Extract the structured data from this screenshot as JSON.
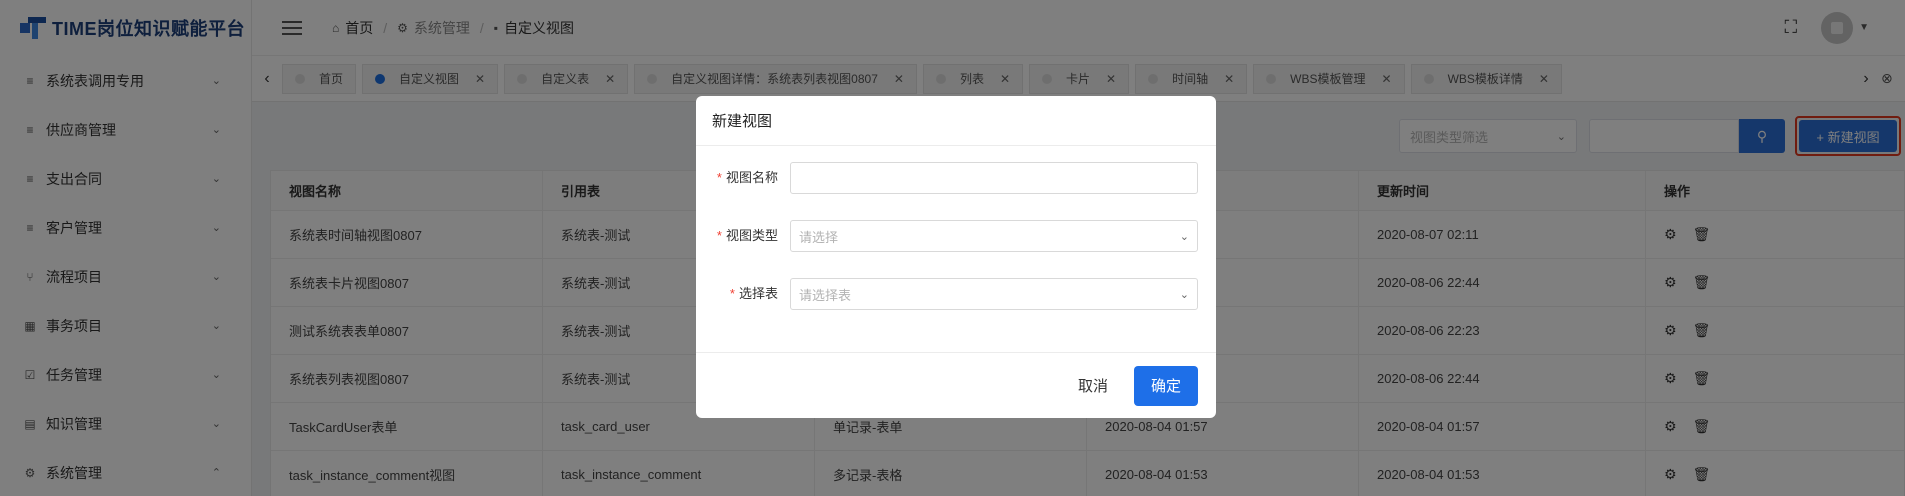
{
  "app": {
    "title": "TIME岗位知识赋能平台"
  },
  "sidebar": {
    "items": [
      {
        "label": "系统表调用专用",
        "icon": "≡",
        "arrow": "⌄"
      },
      {
        "label": "供应商管理",
        "icon": "≡",
        "arrow": "⌄"
      },
      {
        "label": "支出合同",
        "icon": "≡",
        "arrow": "⌄"
      },
      {
        "label": "客户管理",
        "icon": "≡",
        "arrow": "⌄"
      },
      {
        "label": "流程项目",
        "icon": "⑂",
        "arrow": "⌄"
      },
      {
        "label": "事务项目",
        "icon": "▦",
        "arrow": "⌄"
      },
      {
        "label": "任务管理",
        "icon": "☑",
        "arrow": "⌄"
      },
      {
        "label": "知识管理",
        "icon": "▤",
        "arrow": "⌄"
      },
      {
        "label": "系统管理",
        "icon": "⚙",
        "arrow": "⌃"
      }
    ]
  },
  "header": {
    "breadcrumb": [
      {
        "label": "首页",
        "icon": "⌂"
      },
      {
        "label": "系统管理",
        "icon": "⚙"
      },
      {
        "label": "自定义视图",
        "icon": "▪"
      }
    ],
    "separator": "/"
  },
  "tabs": {
    "left_arrow": "‹",
    "right_arrow": "›",
    "close_all": "⊗",
    "items": [
      {
        "label": "首页",
        "closable": false,
        "active": false
      },
      {
        "label": "自定义视图",
        "closable": true,
        "active": true
      },
      {
        "label": "自定义表",
        "closable": true,
        "active": false
      },
      {
        "label": "自定义视图详情：系统表列表视图0807",
        "closable": true,
        "active": false
      },
      {
        "label": "列表",
        "closable": true,
        "active": false
      },
      {
        "label": "卡片",
        "closable": true,
        "active": false
      },
      {
        "label": "时间轴",
        "closable": true,
        "active": false
      },
      {
        "label": "WBS模板管理",
        "closable": true,
        "active": false
      },
      {
        "label": "WBS模板详情",
        "closable": true,
        "active": false
      }
    ]
  },
  "toolbar": {
    "type_filter_placeholder": "视图类型筛选",
    "new_view_label": "+ 新建视图"
  },
  "table": {
    "columns": [
      "视图名称",
      "引用表",
      "",
      "",
      "更新时间",
      "操作"
    ],
    "rows": [
      [
        "系统表时间轴视图0807",
        "系统表-测试",
        "",
        "",
        "2020-08-07 02:11"
      ],
      [
        "系统表卡片视图0807",
        "系统表-测试",
        "",
        "",
        "2020-08-06 22:44"
      ],
      [
        "测试系统表表单0807",
        "系统表-测试",
        "",
        "",
        "2020-08-06 22:23"
      ],
      [
        "系统表列表视图0807",
        "系统表-测试",
        "",
        "",
        "2020-08-06 22:44"
      ],
      [
        "TaskCardUser表单",
        "task_card_user",
        "单记录-表单",
        "2020-08-04 01:57",
        "2020-08-04 01:57"
      ],
      [
        "task_instance_comment视图",
        "task_instance_comment",
        "多记录-表格",
        "2020-08-04 01:53",
        "2020-08-04 01:53"
      ]
    ]
  },
  "modal": {
    "title": "新建视图",
    "fields": [
      {
        "label": "视图名称",
        "value": "",
        "placeholder": ""
      },
      {
        "label": "视图类型",
        "value": "",
        "placeholder": "请选择"
      },
      {
        "label": "选择表",
        "value": "",
        "placeholder": "请选择表"
      }
    ],
    "required_mark": "*",
    "cancel_label": "取消",
    "ok_label": "确定"
  },
  "colors": {
    "primary": "#1e6fe8",
    "highlight_border": "#e0391f",
    "required": "#f04134"
  }
}
